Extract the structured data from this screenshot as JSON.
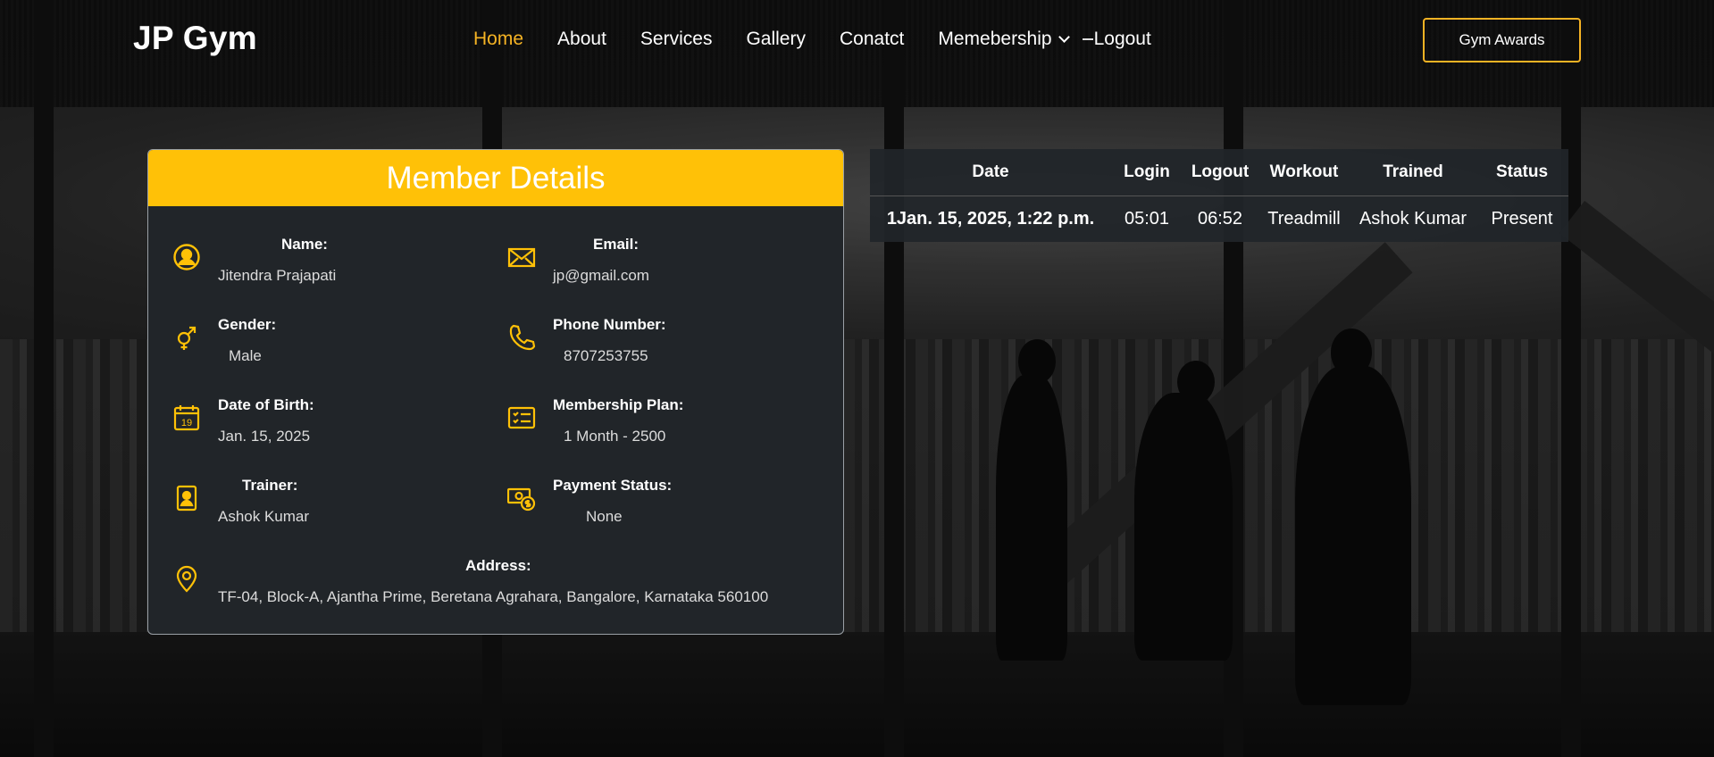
{
  "brand": "JP Gym",
  "nav": {
    "items": [
      {
        "label": "Home"
      },
      {
        "label": "About"
      },
      {
        "label": "Services"
      },
      {
        "label": "Gallery"
      },
      {
        "label": "Conatct"
      },
      {
        "label": "Memebership"
      }
    ],
    "logout": "Logout"
  },
  "awards_button": "Gym Awards",
  "colors": {
    "accent": "#ffc107",
    "card": "#212529",
    "active_nav": "#f5b324"
  },
  "member": {
    "title": "Member Details",
    "name": {
      "label": "Name:",
      "value": "Jitendra Prajapati",
      "icon": "user-circle-icon"
    },
    "email": {
      "label": "Email:",
      "value": "jp@gmail.com",
      "icon": "envelope-icon"
    },
    "gender": {
      "label": "Gender:",
      "value": "Male",
      "icon": "gender-icon"
    },
    "phone": {
      "label": "Phone Number:",
      "value": "8707253755",
      "icon": "phone-icon"
    },
    "dob": {
      "label": "Date of Birth:",
      "value": "Jan. 15, 2025",
      "icon": "calendar-icon",
      "icon_text": "19"
    },
    "plan": {
      "label": "Membership Plan:",
      "value": "1 Month - 2500",
      "icon": "checklist-icon"
    },
    "trainer": {
      "label": "Trainer:",
      "value": "Ashok Kumar",
      "icon": "trainer-badge-icon"
    },
    "payment": {
      "label": "Payment Status:",
      "value": "None",
      "icon": "money-icon"
    },
    "address": {
      "label": "Address:",
      "value": "TF-04, Block-A, Ajantha Prime, Beretana Agrahara, Bangalore, Karnataka 560100",
      "icon": "map-pin-icon"
    }
  },
  "attendance": {
    "headers": [
      "Date",
      "Login",
      "Logout",
      "Workout",
      "Trained",
      "Status"
    ],
    "rows": [
      [
        "1Jan. 15, 2025, 1:22 p.m.",
        "05:01",
        "06:52",
        "Treadmill",
        "Ashok Kumar",
        "Present"
      ]
    ]
  }
}
